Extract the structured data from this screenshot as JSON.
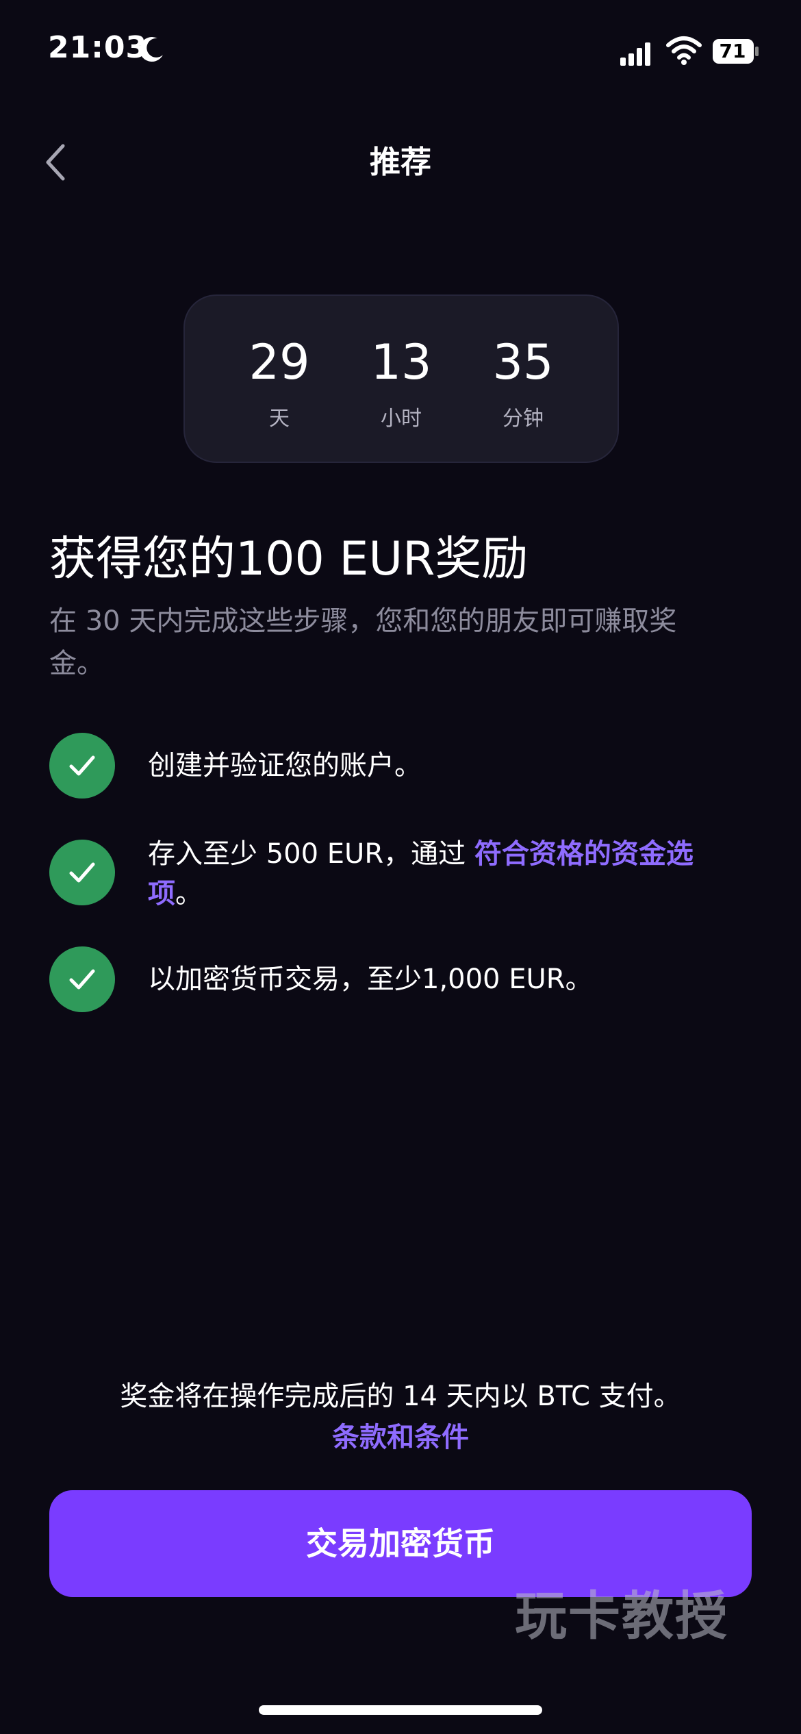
{
  "status_bar": {
    "time": "21:03",
    "battery_level": "71"
  },
  "nav": {
    "title": "推荐"
  },
  "countdown": [
    {
      "value": "29",
      "unit": "天"
    },
    {
      "value": "13",
      "unit": "小时"
    },
    {
      "value": "35",
      "unit": "分钟"
    }
  ],
  "headline": "获得您的100 EUR奖励",
  "subtitle": "在 30 天内完成这些步骤，您和您的朋友即可赚取奖金。",
  "steps": [
    {
      "text": "创建并验证您的账户。",
      "completed": true
    },
    {
      "text_before": "存入至少 500 EUR，通过 ",
      "link": "符合资格的资金选项",
      "text_after": "。",
      "completed": true
    },
    {
      "text": "以加密货币交易，至少1,000 EUR。",
      "completed": true
    }
  ],
  "footer": {
    "payout_note": "奖金将在操作完成后的 14 天内以 BTC 支付。",
    "terms_link": "条款和条件",
    "cta_label": "交易加密货币"
  },
  "watermark": "玩卡教授",
  "colors": {
    "background": "#0b0914",
    "accent": "#7a3cff",
    "link": "#8f6cff",
    "check": "#2f9a5a",
    "card": "#1b1a27"
  },
  "icons": {
    "back": "chevron-left-icon",
    "moon": "moon-icon",
    "signal": "cellular-signal-icon",
    "wifi": "wifi-icon",
    "battery": "battery-icon",
    "check": "check-icon"
  }
}
